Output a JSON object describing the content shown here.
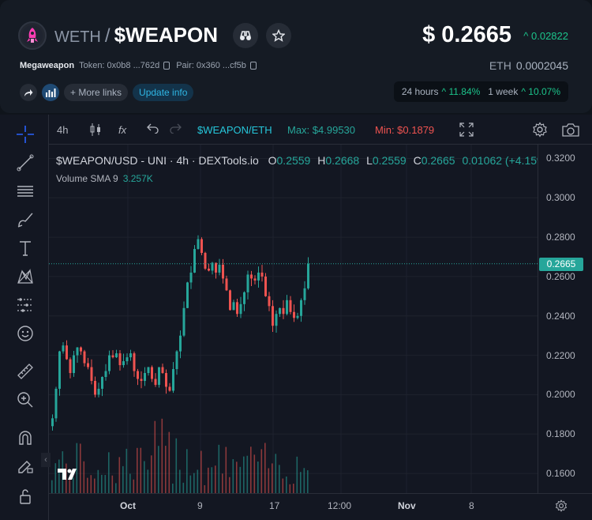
{
  "header": {
    "base_symbol": "WETH",
    "slash": "/",
    "main_symbol": "$WEAPON",
    "price": "$ 0.2665",
    "price_change": "^ 0.02822",
    "token_name": "Megaweapon",
    "token_addr": "Token: 0x0b8 ...762d",
    "pair_addr": "Pair: 0x360 ...cf5b",
    "eth_label": "ETH",
    "eth_price": "0.0002045",
    "more_links": "+ More links",
    "update_info": "Update info",
    "perf_24h_label": "24 hours",
    "perf_24h_value": "^ 11.84%",
    "perf_1w_label": "1 week",
    "perf_1w_value": "^ 10.07%"
  },
  "toolbar": {
    "interval": "4h",
    "fx": "fx",
    "pair": "$WEAPON/ETH",
    "max": "Max: $4.99530",
    "min": "Min: $0.1879",
    "pair_color": "#26c6da",
    "max_color": "#26a69a",
    "min_color": "#ef5350"
  },
  "legend": {
    "symbol": "$WEAPON/USD - UNI · 4h · DEXTools.io",
    "o_label": "O",
    "o_value": "0.2559",
    "h_label": "H",
    "h_value": "0.2668",
    "l_label": "L",
    "l_value": "0.2559",
    "c_label": "C",
    "c_value": "0.2665",
    "change": "0.01062 (+4.15%)",
    "volume_label": "Volume SMA 9",
    "volume_value": "3.257K"
  },
  "price_axis": {
    "ticks": [
      "0.3200",
      "0.3000",
      "0.2800",
      "0.2600",
      "0.2400",
      "0.2200",
      "0.2000",
      "0.1800",
      "0.1600"
    ],
    "current": "0.2665"
  },
  "time_axis": {
    "labels": [
      "Oct",
      "9",
      "17",
      "12:00",
      "Nov",
      "8"
    ]
  },
  "chart_data": {
    "type": "candlestick",
    "interval": "4h",
    "up_color": "#26a69a",
    "down_color": "#ef5350",
    "ylim": [
      0.15,
      0.327
    ],
    "current_price": 0.2665,
    "x_labels": [
      "Oct",
      "9",
      "17",
      "12:00",
      "Nov",
      "8"
    ],
    "approx_close_path": [
      0.188,
      0.203,
      0.222,
      0.225,
      0.218,
      0.211,
      0.22,
      0.224,
      0.222,
      0.216,
      0.214,
      0.207,
      0.2,
      0.203,
      0.209,
      0.212,
      0.22,
      0.219,
      0.221,
      0.215,
      0.217,
      0.219,
      0.221,
      0.212,
      0.208,
      0.207,
      0.211,
      0.214,
      0.208,
      0.205,
      0.214,
      0.211,
      0.204,
      0.202,
      0.213,
      0.222,
      0.23,
      0.244,
      0.257,
      0.262,
      0.274,
      0.279,
      0.272,
      0.264,
      0.263,
      0.267,
      0.262,
      0.266,
      0.259,
      0.253,
      0.243,
      0.247,
      0.241,
      0.246,
      0.252,
      0.261,
      0.259,
      0.258,
      0.262,
      0.26,
      0.25,
      0.245,
      0.235,
      0.241,
      0.244,
      0.241,
      0.248,
      0.242,
      0.239,
      0.24,
      0.248,
      0.254,
      0.2665
    ]
  }
}
